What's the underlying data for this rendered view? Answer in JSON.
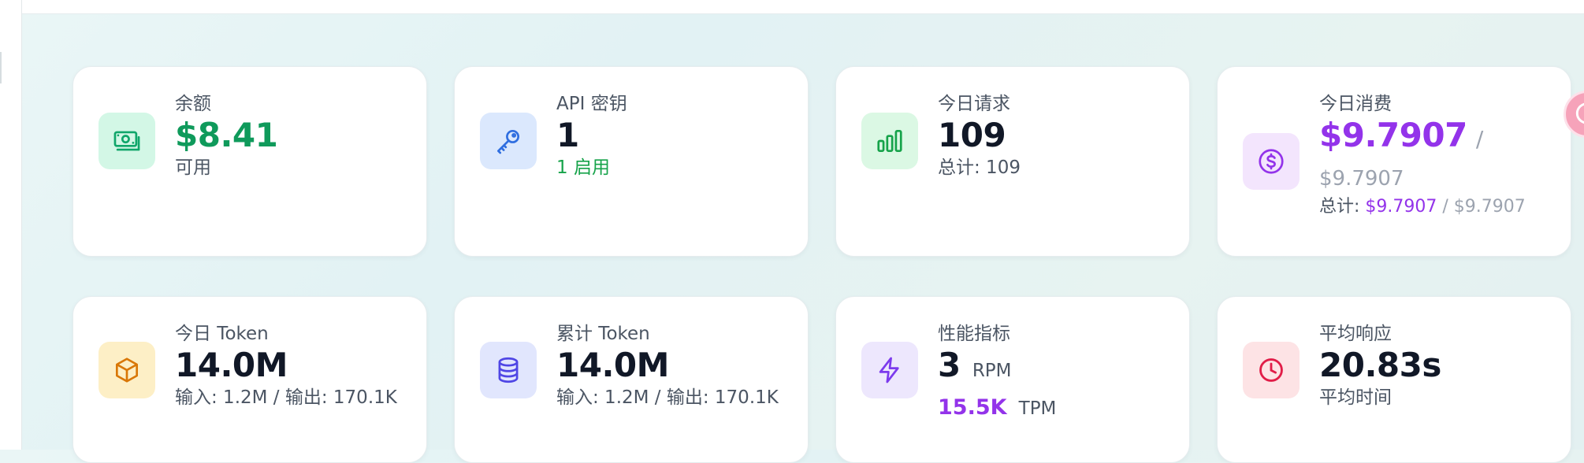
{
  "cards": [
    {
      "label": "余额",
      "value": "$8.41",
      "sub": "可用",
      "icon": "money-icon"
    },
    {
      "label": "API 密钥",
      "value": "1",
      "sub": "1 启用",
      "icon": "key-icon"
    },
    {
      "label": "今日请求",
      "value": "109",
      "sub": "总计: 109",
      "icon": "bar-chart-icon"
    },
    {
      "label": "今日消费",
      "value": "$9.7907",
      "separator": "/",
      "value_limit": "$9.7907",
      "sub_prefix": "总计: ",
      "sub_value": "$9.7907",
      "sub_sep": " / ",
      "sub_limit": "$9.7907",
      "icon": "dollar-circle-icon"
    },
    {
      "label": "今日 Token",
      "value": "14.0M",
      "sub": "输入: 1.2M / 输出: 170.1K",
      "icon": "cube-icon"
    },
    {
      "label": "累计 Token",
      "value": "14.0M",
      "sub": "输入: 1.2M / 输出: 170.1K",
      "icon": "database-icon"
    },
    {
      "label": "性能指标",
      "rpm_value": "3",
      "rpm_unit": "RPM",
      "tpm_value": "15.5K",
      "tpm_unit": "TPM",
      "icon": "lightning-icon"
    },
    {
      "label": "平均响应",
      "value": "20.83s",
      "sub": "平均时间",
      "icon": "clock-icon"
    }
  ],
  "colors": {
    "green": "#0f9a5b",
    "purple": "#9333ea",
    "gray": "#9ca3af",
    "text": "#111827",
    "muted": "#4b5563"
  }
}
